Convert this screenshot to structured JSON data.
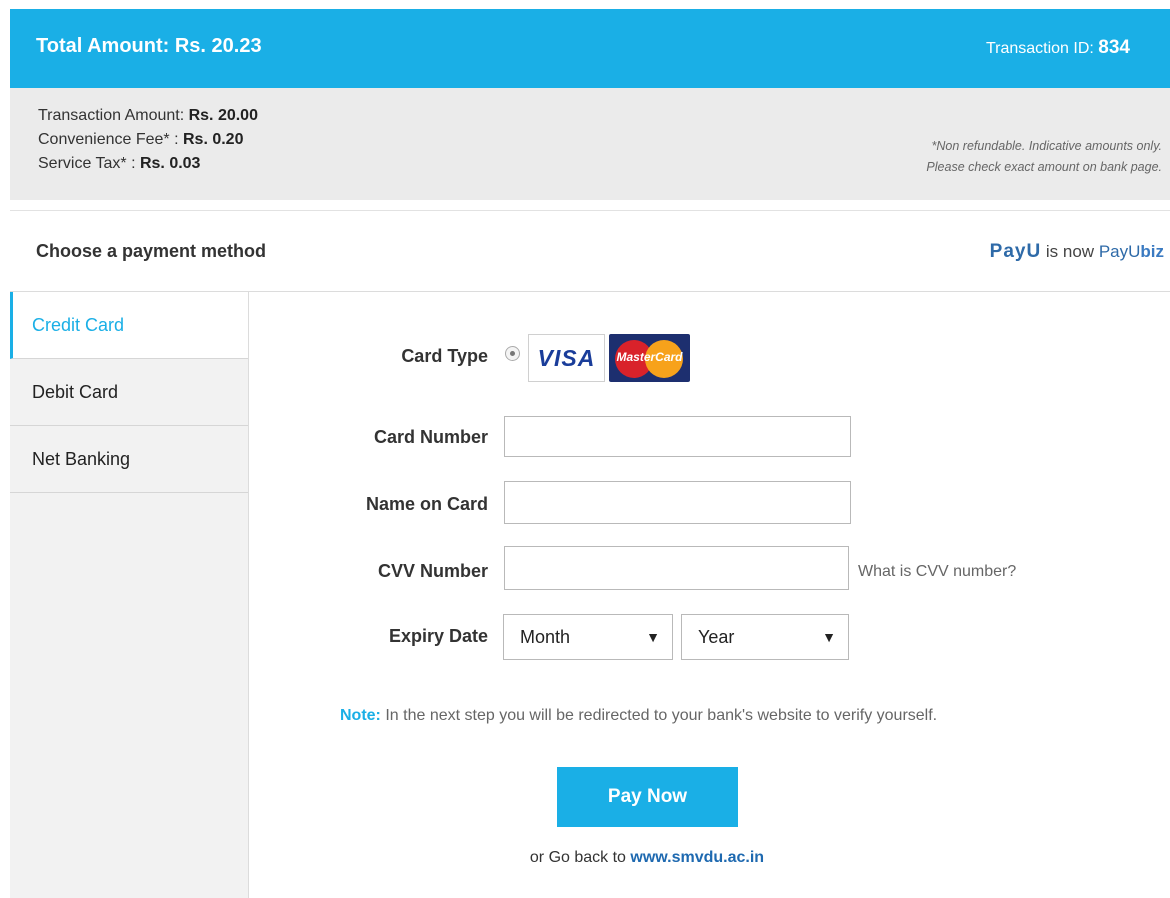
{
  "header": {
    "total_label": "Total Amount: Rs. 20.23",
    "txn_label": "Transaction ID:",
    "txn_id": "834"
  },
  "summary": {
    "transaction_amount_label": "Transaction Amount: ",
    "transaction_amount_value": "Rs. 20.00",
    "convenience_fee_label": "Convenience Fee* : ",
    "convenience_fee_value": "Rs. 0.20",
    "service_tax_label": "Service Tax* : ",
    "service_tax_value": "Rs. 0.03",
    "note_line1": "*Non refundable. Indicative amounts only.",
    "note_line2": "Please check exact amount on bank page."
  },
  "chooser": {
    "title": "Choose a payment method",
    "brand_part1": "PayU",
    "brand_middle": " is now ",
    "brand_part2": "PayU",
    "brand_part3": "biz"
  },
  "tabs": [
    {
      "label": "Credit Card",
      "active": true
    },
    {
      "label": "Debit Card",
      "active": false
    },
    {
      "label": "Net Banking",
      "active": false
    }
  ],
  "form": {
    "card_type_label": "Card Type",
    "visa_text": "VISA",
    "mastercard_text": "MasterCard",
    "card_number_label": "Card Number",
    "card_number_value": "",
    "name_label": "Name on Card",
    "name_value": "",
    "cvv_label": "CVV Number",
    "cvv_value": "",
    "cvv_help": "What is CVV number?",
    "expiry_label": "Expiry Date",
    "month_selected": "Month",
    "year_selected": "Year",
    "dropdown_arrow": "▼"
  },
  "note": {
    "prefix": "Note:",
    "text": " In the next step you will be redirected to your bank's website to verify yourself."
  },
  "pay_button": "Pay Now",
  "go_back": {
    "prefix": "or Go back to ",
    "link": "www.smvdu.ac.in"
  },
  "colors": {
    "accent": "#1aafe6",
    "summary_bg": "#ebebeb",
    "sidebar_bg": "#f2f2f2",
    "link": "#1e69b0"
  }
}
